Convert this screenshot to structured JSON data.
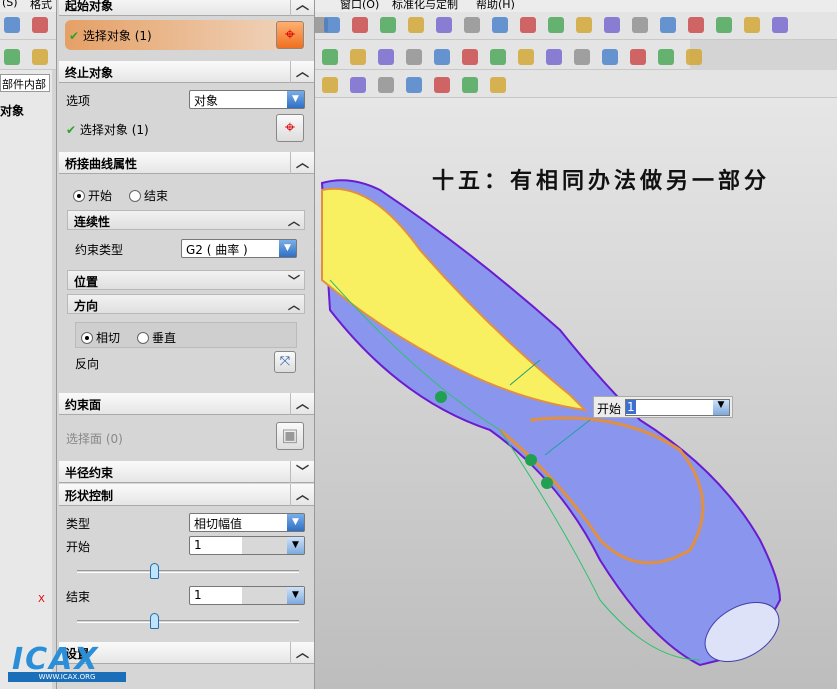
{
  "menu": {
    "items": [
      "(S)",
      "格式",
      "窗口(O)",
      "标准化与定制",
      "帮助(H)"
    ]
  },
  "left": {
    "filter_value": "部件内部",
    "label": "对象"
  },
  "panel": {
    "start_object": {
      "title": "起始对象",
      "select": "选择对象 (1)"
    },
    "end_object": {
      "title": "终止对象",
      "option_label": "选项",
      "option_value": "对象",
      "select": "选择对象 (1)"
    },
    "bridge": {
      "title": "桥接曲线属性",
      "radio_start": "开始",
      "radio_end": "结束",
      "continuity": {
        "title": "连续性",
        "constraint_label": "约束类型",
        "constraint_value": "G2 ( 曲率 )"
      },
      "position": {
        "title": "位置"
      },
      "direction": {
        "title": "方向",
        "tangent": "相切",
        "normal": "垂直",
        "reverse": "反向"
      }
    },
    "constraint_face": {
      "title": "约束面",
      "select": "选择面 (0)"
    },
    "radius": {
      "title": "半径约束"
    },
    "shape": {
      "title": "形状控制",
      "type_label": "类型",
      "type_value": "相切幅值",
      "start_label": "开始",
      "start_value": "1",
      "start_slider": 0.33,
      "end_label": "结束",
      "end_value": "1",
      "end_slider": 0.33
    },
    "settings": {
      "title": "设置"
    }
  },
  "viewport": {
    "annotation": "十五：有相同办法做另一部分",
    "float_label": "开始",
    "float_value": "1",
    "axis_label": "X"
  },
  "watermark": {
    "logo": "ICAX",
    "url": "WWW.ICAX.ORG"
  }
}
